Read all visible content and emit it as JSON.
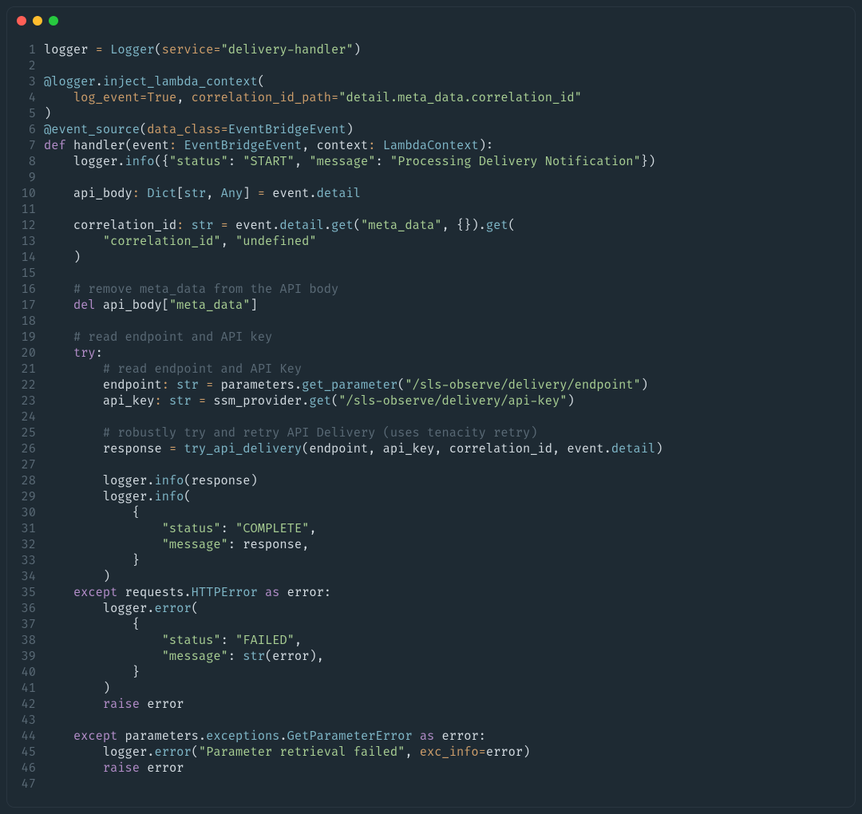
{
  "window": {
    "dots": [
      "red",
      "yellow",
      "green"
    ]
  },
  "code": {
    "language": "python",
    "lines": [
      {
        "n": 1,
        "t": [
          [
            "c-id",
            "logger "
          ],
          [
            "c-op",
            "="
          ],
          [
            "c-id",
            " "
          ],
          [
            "c-call",
            "Logger"
          ],
          [
            "c-id",
            "("
          ],
          [
            "c-param",
            "service"
          ],
          [
            "c-op",
            "="
          ],
          [
            "c-str",
            "\"delivery-handler\""
          ],
          [
            "c-id",
            ")"
          ]
        ]
      },
      {
        "n": 2,
        "t": []
      },
      {
        "n": 3,
        "t": [
          [
            "c-dec",
            "@logger"
          ],
          [
            "c-id",
            "."
          ],
          [
            "c-call",
            "inject_lambda_context"
          ],
          [
            "c-id",
            "("
          ]
        ]
      },
      {
        "n": 4,
        "t": [
          [
            "c-id",
            "    "
          ],
          [
            "c-param",
            "log_event"
          ],
          [
            "c-op",
            "="
          ],
          [
            "c-num",
            "True"
          ],
          [
            "c-id",
            ", "
          ],
          [
            "c-param",
            "correlation_id_path"
          ],
          [
            "c-op",
            "="
          ],
          [
            "c-str",
            "\"detail.meta_data.correlation_id\""
          ]
        ]
      },
      {
        "n": 5,
        "t": [
          [
            "c-id",
            ")"
          ]
        ]
      },
      {
        "n": 6,
        "t": [
          [
            "c-dec",
            "@event_source"
          ],
          [
            "c-id",
            "("
          ],
          [
            "c-param",
            "data_class"
          ],
          [
            "c-op",
            "="
          ],
          [
            "c-type",
            "EventBridgeEvent"
          ],
          [
            "c-id",
            ")"
          ]
        ]
      },
      {
        "n": 7,
        "t": [
          [
            "c-kw",
            "def"
          ],
          [
            "c-id",
            " "
          ],
          [
            "c-fn",
            "handler"
          ],
          [
            "c-id",
            "("
          ],
          [
            "c-id",
            "event"
          ],
          [
            "c-op",
            ":"
          ],
          [
            "c-id",
            " "
          ],
          [
            "c-type",
            "EventBridgeEvent"
          ],
          [
            "c-id",
            ", "
          ],
          [
            "c-id",
            "context"
          ],
          [
            "c-op",
            ":"
          ],
          [
            "c-id",
            " "
          ],
          [
            "c-type",
            "LambdaContext"
          ],
          [
            "c-id",
            "):"
          ]
        ]
      },
      {
        "n": 8,
        "t": [
          [
            "c-id",
            "    logger."
          ],
          [
            "c-call",
            "info"
          ],
          [
            "c-id",
            "({"
          ],
          [
            "c-str",
            "\"status\""
          ],
          [
            "c-id",
            ": "
          ],
          [
            "c-str",
            "\"START\""
          ],
          [
            "c-id",
            ", "
          ],
          [
            "c-str",
            "\"message\""
          ],
          [
            "c-id",
            ": "
          ],
          [
            "c-str",
            "\"Processing Delivery Notification\""
          ],
          [
            "c-id",
            "})"
          ]
        ]
      },
      {
        "n": 9,
        "t": []
      },
      {
        "n": 10,
        "t": [
          [
            "c-id",
            "    api_body"
          ],
          [
            "c-op",
            ":"
          ],
          [
            "c-id",
            " "
          ],
          [
            "c-type",
            "Dict"
          ],
          [
            "c-id",
            "["
          ],
          [
            "c-type",
            "str"
          ],
          [
            "c-id",
            ", "
          ],
          [
            "c-type",
            "Any"
          ],
          [
            "c-id",
            "] "
          ],
          [
            "c-op",
            "="
          ],
          [
            "c-id",
            " event."
          ],
          [
            "c-attr",
            "detail"
          ]
        ]
      },
      {
        "n": 11,
        "t": []
      },
      {
        "n": 12,
        "t": [
          [
            "c-id",
            "    correlation_id"
          ],
          [
            "c-op",
            ":"
          ],
          [
            "c-id",
            " "
          ],
          [
            "c-type",
            "str"
          ],
          [
            "c-id",
            " "
          ],
          [
            "c-op",
            "="
          ],
          [
            "c-id",
            " event."
          ],
          [
            "c-attr",
            "detail"
          ],
          [
            "c-id",
            "."
          ],
          [
            "c-call",
            "get"
          ],
          [
            "c-id",
            "("
          ],
          [
            "c-str",
            "\"meta_data\""
          ],
          [
            "c-id",
            ", {})."
          ],
          [
            "c-call",
            "get"
          ],
          [
            "c-id",
            "("
          ]
        ]
      },
      {
        "n": 13,
        "t": [
          [
            "c-id",
            "        "
          ],
          [
            "c-str",
            "\"correlation_id\""
          ],
          [
            "c-id",
            ", "
          ],
          [
            "c-str",
            "\"undefined\""
          ]
        ]
      },
      {
        "n": 14,
        "t": [
          [
            "c-id",
            "    )"
          ]
        ]
      },
      {
        "n": 15,
        "t": []
      },
      {
        "n": 16,
        "t": [
          [
            "c-id",
            "    "
          ],
          [
            "c-comm",
            "# remove meta_data from the API body"
          ]
        ]
      },
      {
        "n": 17,
        "t": [
          [
            "c-id",
            "    "
          ],
          [
            "c-kw",
            "del"
          ],
          [
            "c-id",
            " api_body["
          ],
          [
            "c-str",
            "\"meta_data\""
          ],
          [
            "c-id",
            "]"
          ]
        ]
      },
      {
        "n": 18,
        "t": []
      },
      {
        "n": 19,
        "t": [
          [
            "c-id",
            "    "
          ],
          [
            "c-comm",
            "# read endpoint and API key"
          ]
        ]
      },
      {
        "n": 20,
        "t": [
          [
            "c-id",
            "    "
          ],
          [
            "c-kw",
            "try"
          ],
          [
            "c-id",
            ":"
          ]
        ]
      },
      {
        "n": 21,
        "t": [
          [
            "c-id",
            "        "
          ],
          [
            "c-comm",
            "# read endpoint and API Key"
          ]
        ]
      },
      {
        "n": 22,
        "t": [
          [
            "c-id",
            "        endpoint"
          ],
          [
            "c-op",
            ":"
          ],
          [
            "c-id",
            " "
          ],
          [
            "c-type",
            "str"
          ],
          [
            "c-id",
            " "
          ],
          [
            "c-op",
            "="
          ],
          [
            "c-id",
            " parameters."
          ],
          [
            "c-call",
            "get_parameter"
          ],
          [
            "c-id",
            "("
          ],
          [
            "c-str",
            "\"/sls-observe/delivery/endpoint\""
          ],
          [
            "c-id",
            ")"
          ]
        ]
      },
      {
        "n": 23,
        "t": [
          [
            "c-id",
            "        api_key"
          ],
          [
            "c-op",
            ":"
          ],
          [
            "c-id",
            " "
          ],
          [
            "c-type",
            "str"
          ],
          [
            "c-id",
            " "
          ],
          [
            "c-op",
            "="
          ],
          [
            "c-id",
            " ssm_provider."
          ],
          [
            "c-call",
            "get"
          ],
          [
            "c-id",
            "("
          ],
          [
            "c-str",
            "\"/sls-observe/delivery/api-key\""
          ],
          [
            "c-id",
            ")"
          ]
        ]
      },
      {
        "n": 24,
        "t": []
      },
      {
        "n": 25,
        "t": [
          [
            "c-id",
            "        "
          ],
          [
            "c-comm",
            "# robustly try and retry API Delivery (uses tenacity retry)"
          ]
        ]
      },
      {
        "n": 26,
        "t": [
          [
            "c-id",
            "        response "
          ],
          [
            "c-op",
            "="
          ],
          [
            "c-id",
            " "
          ],
          [
            "c-call",
            "try_api_delivery"
          ],
          [
            "c-id",
            "(endpoint, api_key, correlation_id, event."
          ],
          [
            "c-attr",
            "detail"
          ],
          [
            "c-id",
            ")"
          ]
        ]
      },
      {
        "n": 27,
        "t": []
      },
      {
        "n": 28,
        "t": [
          [
            "c-id",
            "        logger."
          ],
          [
            "c-call",
            "info"
          ],
          [
            "c-id",
            "(response)"
          ]
        ]
      },
      {
        "n": 29,
        "t": [
          [
            "c-id",
            "        logger."
          ],
          [
            "c-call",
            "info"
          ],
          [
            "c-id",
            "("
          ]
        ]
      },
      {
        "n": 30,
        "t": [
          [
            "c-id",
            "            {"
          ]
        ]
      },
      {
        "n": 31,
        "t": [
          [
            "c-id",
            "                "
          ],
          [
            "c-str",
            "\"status\""
          ],
          [
            "c-id",
            ": "
          ],
          [
            "c-str",
            "\"COMPLETE\""
          ],
          [
            "c-id",
            ","
          ]
        ]
      },
      {
        "n": 32,
        "t": [
          [
            "c-id",
            "                "
          ],
          [
            "c-str",
            "\"message\""
          ],
          [
            "c-id",
            ": response,"
          ]
        ]
      },
      {
        "n": 33,
        "t": [
          [
            "c-id",
            "            }"
          ]
        ]
      },
      {
        "n": 34,
        "t": [
          [
            "c-id",
            "        )"
          ]
        ]
      },
      {
        "n": 35,
        "t": [
          [
            "c-id",
            "    "
          ],
          [
            "c-kw",
            "except"
          ],
          [
            "c-id",
            " requests."
          ],
          [
            "c-type",
            "HTTPError"
          ],
          [
            "c-id",
            " "
          ],
          [
            "c-kw",
            "as"
          ],
          [
            "c-id",
            " error:"
          ]
        ]
      },
      {
        "n": 36,
        "t": [
          [
            "c-id",
            "        logger."
          ],
          [
            "c-call",
            "error"
          ],
          [
            "c-id",
            "("
          ]
        ]
      },
      {
        "n": 37,
        "t": [
          [
            "c-id",
            "            {"
          ]
        ]
      },
      {
        "n": 38,
        "t": [
          [
            "c-id",
            "                "
          ],
          [
            "c-str",
            "\"status\""
          ],
          [
            "c-id",
            ": "
          ],
          [
            "c-str",
            "\"FAILED\""
          ],
          [
            "c-id",
            ","
          ]
        ]
      },
      {
        "n": 39,
        "t": [
          [
            "c-id",
            "                "
          ],
          [
            "c-str",
            "\"message\""
          ],
          [
            "c-id",
            ": "
          ],
          [
            "c-call",
            "str"
          ],
          [
            "c-id",
            "(error),"
          ]
        ]
      },
      {
        "n": 40,
        "t": [
          [
            "c-id",
            "            }"
          ]
        ]
      },
      {
        "n": 41,
        "t": [
          [
            "c-id",
            "        )"
          ]
        ]
      },
      {
        "n": 42,
        "t": [
          [
            "c-id",
            "        "
          ],
          [
            "c-kw",
            "raise"
          ],
          [
            "c-id",
            " error"
          ]
        ]
      },
      {
        "n": 43,
        "t": []
      },
      {
        "n": 44,
        "t": [
          [
            "c-id",
            "    "
          ],
          [
            "c-kw",
            "except"
          ],
          [
            "c-id",
            " parameters."
          ],
          [
            "c-attr",
            "exceptions"
          ],
          [
            "c-id",
            "."
          ],
          [
            "c-type",
            "GetParameterError"
          ],
          [
            "c-id",
            " "
          ],
          [
            "c-kw",
            "as"
          ],
          [
            "c-id",
            " error:"
          ]
        ]
      },
      {
        "n": 45,
        "t": [
          [
            "c-id",
            "        logger."
          ],
          [
            "c-call",
            "error"
          ],
          [
            "c-id",
            "("
          ],
          [
            "c-str",
            "\"Parameter retrieval failed\""
          ],
          [
            "c-id",
            ", "
          ],
          [
            "c-param",
            "exc_info"
          ],
          [
            "c-op",
            "="
          ],
          [
            "c-id",
            "error)"
          ]
        ]
      },
      {
        "n": 46,
        "t": [
          [
            "c-id",
            "        "
          ],
          [
            "c-kw",
            "raise"
          ],
          [
            "c-id",
            " error"
          ]
        ]
      },
      {
        "n": 47,
        "t": []
      }
    ]
  }
}
